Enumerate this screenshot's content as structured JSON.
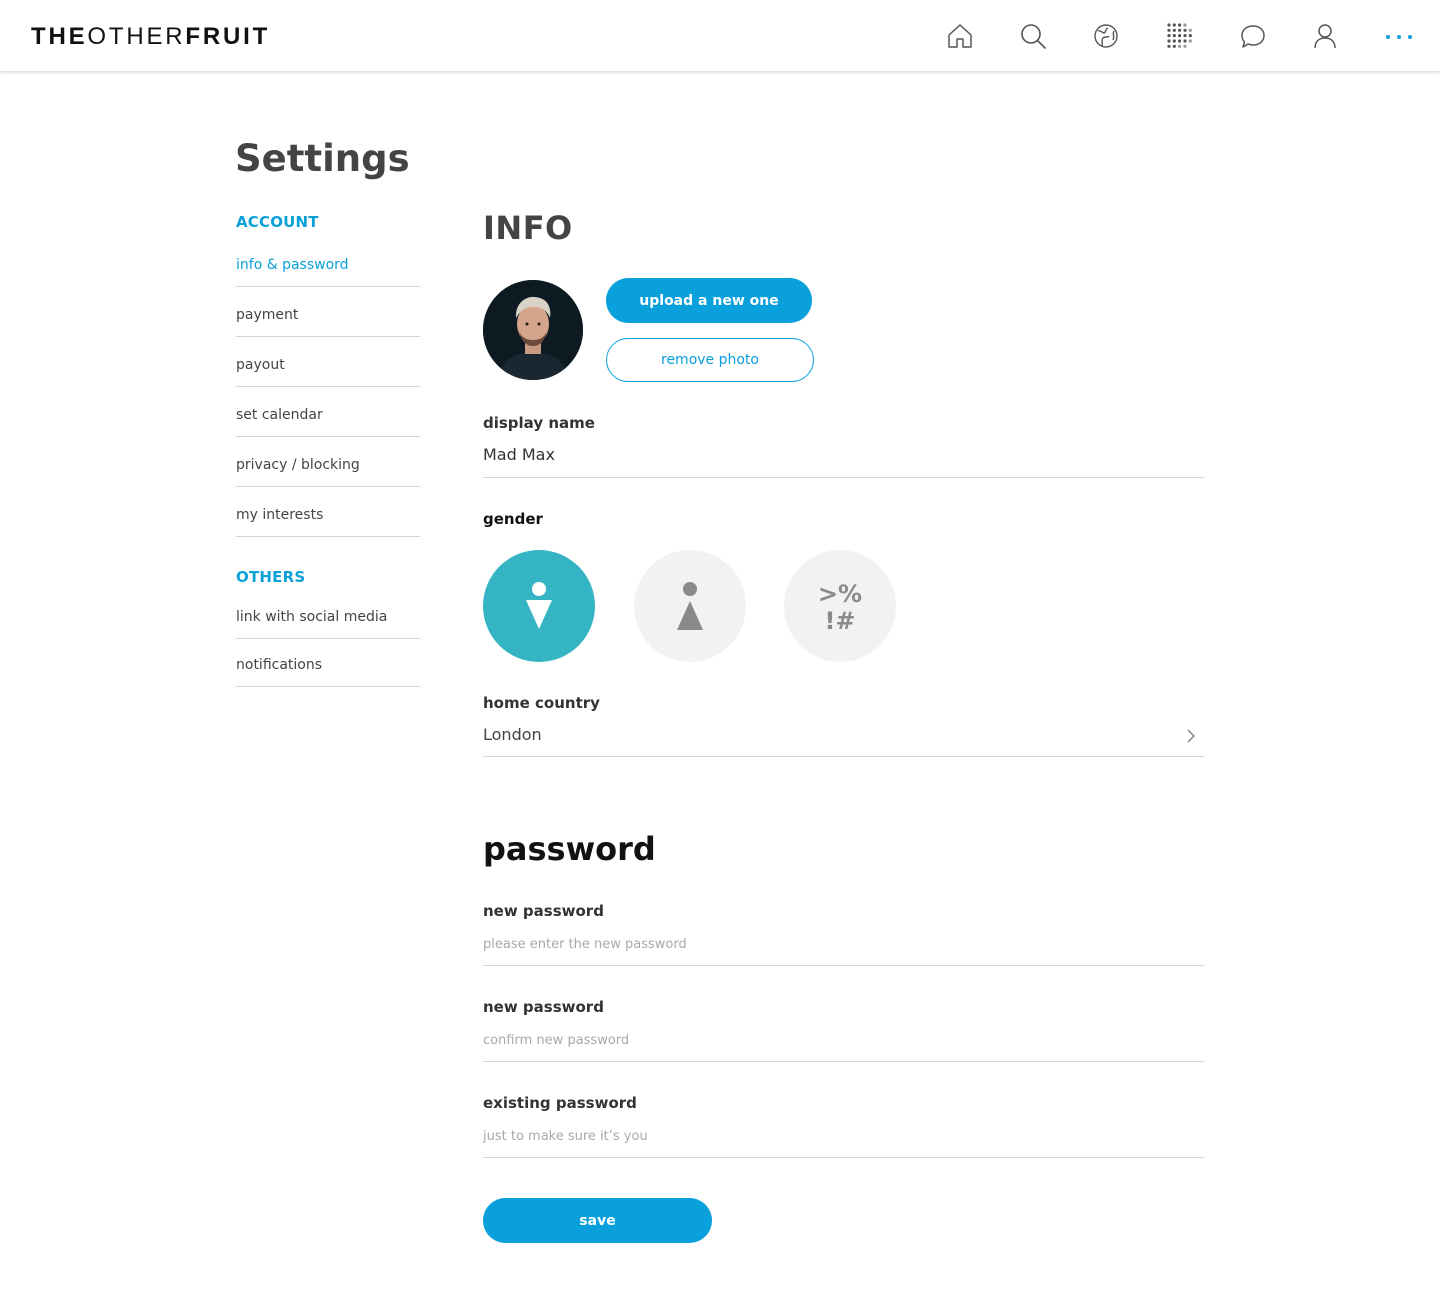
{
  "header": {
    "logo_bold_1": "THE",
    "logo_light": "OTHER",
    "logo_bold_2": "FRUIT",
    "nav_icons": [
      "home-icon",
      "search-icon",
      "globe-icon",
      "grid-dots-icon",
      "chat-icon",
      "user-icon",
      "more-icon"
    ],
    "accent_color": "#0aa0dc"
  },
  "page": {
    "title": "Settings"
  },
  "sidebar": {
    "account_heading": "ACCOUNT",
    "account_items": [
      {
        "label": "info & password",
        "active": true
      },
      {
        "label": "payment"
      },
      {
        "label": "payout"
      },
      {
        "label": "set calendar"
      },
      {
        "label": "privacy / blocking"
      },
      {
        "label": "my interests"
      }
    ],
    "others_heading": "OTHERS",
    "others_items": [
      {
        "label": "link with social media"
      },
      {
        "label": "notifications"
      }
    ]
  },
  "info": {
    "heading": "INFO",
    "upload_label": "upload a new one",
    "remove_label": "remove photo",
    "display_name_label": "display name",
    "display_name_value": "Mad Max",
    "gender_label": "gender",
    "gender_options": [
      {
        "name": "male",
        "selected": true
      },
      {
        "name": "female",
        "selected": false
      },
      {
        "name": "other",
        "selected": false,
        "symbol_top": ">%",
        "symbol_bottom": "!#"
      }
    ],
    "home_country_label": "home country",
    "home_country_value": "London"
  },
  "password": {
    "heading": "password",
    "new_label": "new password",
    "new_placeholder": "please enter the new password",
    "confirm_label": "new password",
    "confirm_placeholder": "confirm new password",
    "existing_label": "existing password",
    "existing_placeholder": "just to make sure it’s you",
    "save_label": "save"
  }
}
